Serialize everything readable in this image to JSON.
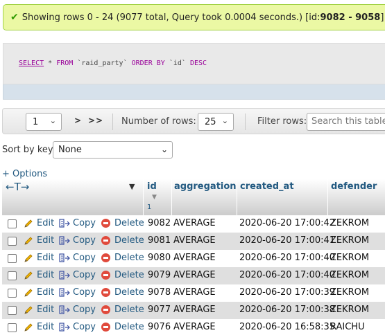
{
  "banner": {
    "text_prefix": "Showing rows 0 - 24 (9077 total, Query took 0.0004 seconds.) [id: ",
    "range": "9082 - 9058",
    "text_suffix": "]"
  },
  "sql": {
    "select": "SELECT",
    "star": "*",
    "from": "FROM",
    "table": "`raid_party`",
    "order_by": "ORDER BY",
    "col": "`id`",
    "dir": "DESC"
  },
  "nav": {
    "page": "1",
    "next": ">",
    "last": ">>",
    "rows_label": "Number of rows:",
    "rows_value": "25",
    "filter_label": "Filter rows:",
    "filter_placeholder": "Search this table"
  },
  "sort": {
    "label": "Sort by key:",
    "value": "None"
  },
  "options_link": "+ Options",
  "table": {
    "arrows": "←T→",
    "sort_caret": "▼",
    "sort_index": "1",
    "columns": [
      "id",
      "aggregation",
      "created_at",
      "defender"
    ],
    "actions": {
      "edit": "Edit",
      "copy": "Copy",
      "delete": "Delete"
    },
    "rows": [
      {
        "id": "9082",
        "aggregation": "AVERAGE",
        "created_at": "2020-06-20 17:00:42",
        "defender": "ZEKROM"
      },
      {
        "id": "9081",
        "aggregation": "AVERAGE",
        "created_at": "2020-06-20 17:00:41",
        "defender": "ZEKROM"
      },
      {
        "id": "9080",
        "aggregation": "AVERAGE",
        "created_at": "2020-06-20 17:00:40",
        "defender": "ZEKROM"
      },
      {
        "id": "9079",
        "aggregation": "AVERAGE",
        "created_at": "2020-06-20 17:00:40",
        "defender": "ZEKROM"
      },
      {
        "id": "9078",
        "aggregation": "AVERAGE",
        "created_at": "2020-06-20 17:00:39",
        "defender": "ZEKROM"
      },
      {
        "id": "9077",
        "aggregation": "AVERAGE",
        "created_at": "2020-06-20 17:00:38",
        "defender": "ZEKROM"
      },
      {
        "id": "9076",
        "aggregation": "AVERAGE",
        "created_at": "2020-06-20 16:58:35",
        "defender": "RAICHU"
      }
    ]
  },
  "colors": {
    "link": "#235a81",
    "success_bg": "#ebf8a4",
    "delete": "#e04a3c"
  }
}
